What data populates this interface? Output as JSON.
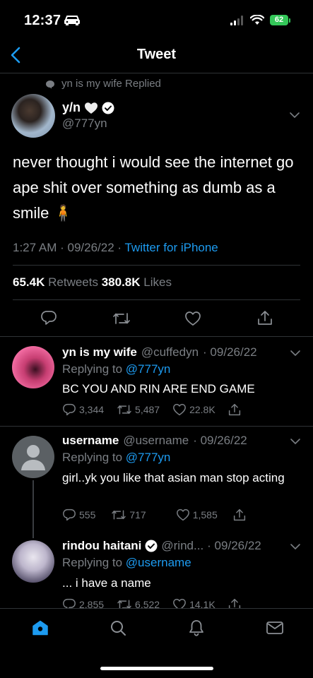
{
  "status_bar": {
    "time": "12:37",
    "battery": "62"
  },
  "nav": {
    "title": "Tweet"
  },
  "main_tweet": {
    "social_context": "yn is my wife Replied",
    "author_name": "y/n",
    "author_handle": "@777yn",
    "text": "never thought i would see the internet go ape shit over something as dumb as a smile 🧍",
    "time": "1:27 AM",
    "date": "09/26/22",
    "source": "Twitter for iPhone",
    "retweets_count": "65.4K",
    "retweets_label": "Retweets",
    "likes_count": "380.8K",
    "likes_label": "Likes"
  },
  "replies": [
    {
      "name": "yn is my wife",
      "handle": "@cuffedyn",
      "date": "· 09/26/22",
      "replying_label": "Replying to",
      "replying_to": "@777yn",
      "text": "BC YOU AND RIN ARE END GAME",
      "replies": "3,344",
      "retweets": "5,487",
      "likes": "22.8K"
    },
    {
      "name": "username",
      "handle": "@username",
      "date": "· 09/26/22",
      "replying_label": "Replying to",
      "replying_to": "@777yn",
      "text": "girl..yk you like that asian man stop acting",
      "replies": "555",
      "retweets": "717",
      "likes": "1,585"
    },
    {
      "name": "rindou haitani",
      "handle": "@rind...",
      "date": "· 09/26/22",
      "replying_label": "Replying to",
      "replying_to": "@username",
      "text": "... i have a name",
      "replies": "2,855",
      "retweets": "6,522",
      "likes": "14.1K"
    }
  ],
  "tab_bar": [
    "home-icon",
    "search-icon",
    "notifications-icon",
    "messages-icon"
  ],
  "colors": {
    "accent": "#1d9bf0",
    "muted": "#7a7e83",
    "divider": "#2f3336",
    "battery": "#34c759"
  }
}
